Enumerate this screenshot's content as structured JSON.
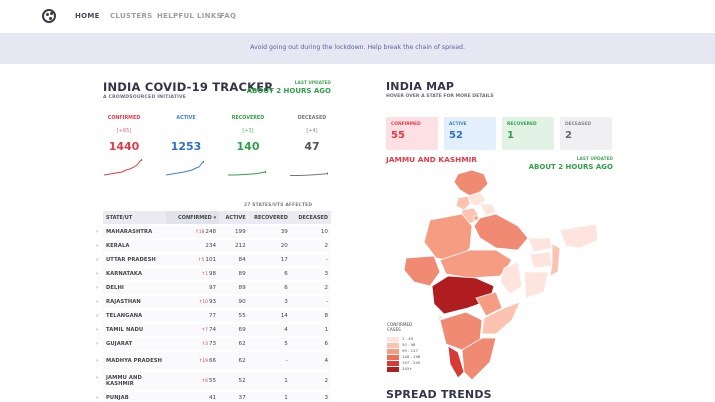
{
  "nav": {
    "items": [
      "HOME",
      "CLUSTERS",
      "HELPFUL LINKS",
      "FAQ"
    ]
  },
  "banner": "Avoid going out during the lockdown. Help break the chain of spread.",
  "tracker": {
    "title": "INDIA COVID-19 TRACKER",
    "subtitle": "A CROWDSOURCED INITIATIVE",
    "last_updated_label": "LAST UPDATED",
    "last_updated_value": "ABOUT 2 HOURS AGO",
    "stats": [
      {
        "label": "CONFIRMED",
        "delta": "[+85]",
        "value": "1440",
        "color": "#e23b48"
      },
      {
        "label": "ACTIVE",
        "delta": "",
        "value": "1253",
        "color": "#3b7ed6"
      },
      {
        "label": "RECOVERED",
        "delta": "[+3]",
        "value": "140",
        "color": "#2fa146"
      },
      {
        "label": "DECEASED",
        "delta": "[+4]",
        "value": "47",
        "color": "#666671"
      }
    ]
  },
  "table": {
    "affected": "27 STATES/UTS AFFECTED",
    "headers": [
      "STATE/UT",
      "CONFIRMED",
      "ACTIVE",
      "RECOVERED",
      "DECEASED"
    ],
    "sort_indicator": "▾",
    "rows": [
      {
        "state": "MAHARASHTRA",
        "inc": "↑18",
        "confirmed": "248",
        "active": "199",
        "recovered": "39",
        "deceased": "10"
      },
      {
        "state": "KERALA",
        "inc": "",
        "confirmed": "234",
        "active": "212",
        "recovered": "20",
        "deceased": "2"
      },
      {
        "state": "UTTAR PRADESH",
        "inc": "↑5",
        "confirmed": "101",
        "active": "84",
        "recovered": "17",
        "deceased": "-"
      },
      {
        "state": "KARNATAKA",
        "inc": "↑1",
        "confirmed": "98",
        "active": "89",
        "recovered": "6",
        "deceased": "3"
      },
      {
        "state": "DELHI",
        "inc": "",
        "confirmed": "97",
        "active": "89",
        "recovered": "6",
        "deceased": "2"
      },
      {
        "state": "RAJASTHAN",
        "inc": "↑10",
        "confirmed": "93",
        "active": "90",
        "recovered": "3",
        "deceased": "-"
      },
      {
        "state": "TELANGANA",
        "inc": "",
        "confirmed": "77",
        "active": "55",
        "recovered": "14",
        "deceased": "8"
      },
      {
        "state": "TAMIL NADU",
        "inc": "↑7",
        "confirmed": "74",
        "active": "69",
        "recovered": "4",
        "deceased": "1"
      },
      {
        "state": "GUJARAT",
        "inc": "↑3",
        "confirmed": "73",
        "active": "62",
        "recovered": "5",
        "deceased": "6"
      },
      {
        "state": "MADHYA PRADESH",
        "inc": "↑19",
        "confirmed": "66",
        "active": "62",
        "recovered": "-",
        "deceased": "4",
        "tall": true
      },
      {
        "state": "JAMMU AND KASHMIR",
        "inc": "↑6",
        "confirmed": "55",
        "active": "52",
        "recovered": "1",
        "deceased": "2",
        "tall": true
      },
      {
        "state": "PUNJAB",
        "inc": "",
        "confirmed": "41",
        "active": "37",
        "recovered": "1",
        "deceased": "3"
      }
    ]
  },
  "map": {
    "title": "INDIA MAP",
    "subtitle": "HOVER OVER A STATE FOR MORE DETAILS",
    "boxes": [
      {
        "label": "CONFIRMED",
        "value": "55",
        "bg": "#fde0e3",
        "color": "#e23b48"
      },
      {
        "label": "ACTIVE",
        "value": "52",
        "bg": "#e4effc",
        "color": "#3b7ed6"
      },
      {
        "label": "RECOVERED",
        "value": "1",
        "bg": "#e2f3e5",
        "color": "#2fa146"
      },
      {
        "label": "DECEASED",
        "value": "2",
        "bg": "#f0f0f2",
        "color": "#666671"
      }
    ],
    "selected_state": "JAMMU AND KASHMIR",
    "last_updated_label": "LAST UPDATED",
    "last_updated_value": "ABOUT 2 HOURS AGO",
    "legend_title": [
      "CONFIRMED",
      "CASES"
    ],
    "legend": [
      {
        "range": "1 - 49",
        "color": "#fde4dc"
      },
      {
        "range": "50 - 98",
        "color": "#fbc3b0"
      },
      {
        "range": "99 - 147",
        "color": "#f69c83"
      },
      {
        "range": "148 - 196",
        "color": "#ec6f56"
      },
      {
        "range": "197 - 245",
        "color": "#d63a34"
      },
      {
        "range": "245+",
        "color": "#b01d20"
      }
    ]
  },
  "spread_trends": "SPREAD TRENDS"
}
